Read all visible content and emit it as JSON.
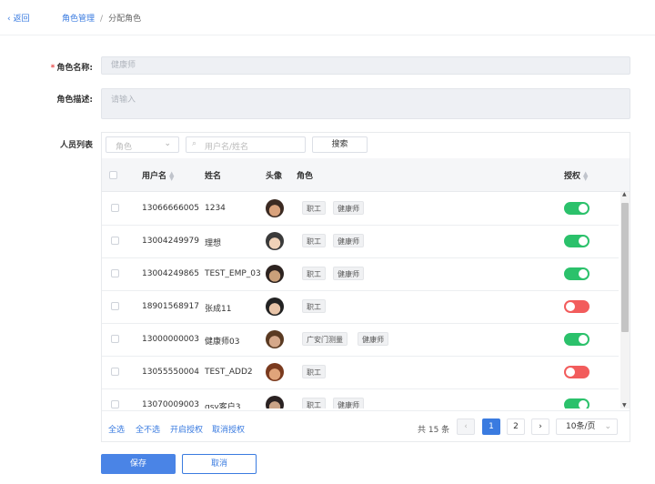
{
  "header": {
    "back_label": "返回",
    "breadcrumb": [
      "角色管理",
      "分配角色"
    ]
  },
  "form": {
    "role_name_label": "角色名称:",
    "role_name_value": "健康师",
    "role_desc_label": "角色描述:",
    "role_desc_placeholder": "请输入",
    "members_label": "人员列表"
  },
  "filters": {
    "role_placeholder": "角色",
    "search_placeholder": "用户名/姓名",
    "search_button": "搜索"
  },
  "table": {
    "columns": [
      "用户名",
      "姓名",
      "头像",
      "角色",
      "授权"
    ],
    "rows": [
      {
        "username": "13066666005",
        "name": "1234",
        "roles": [
          "职工",
          "健康师"
        ],
        "authorized": true
      },
      {
        "username": "13004249979",
        "name": "理想",
        "roles": [
          "职工",
          "健康师"
        ],
        "authorized": true
      },
      {
        "username": "13004249865",
        "name": "TEST_EMP_03",
        "roles": [
          "职工",
          "健康师"
        ],
        "authorized": true
      },
      {
        "username": "18901568917",
        "name": "张成11",
        "roles": [
          "职工"
        ],
        "authorized": false
      },
      {
        "username": "13000000003",
        "name": "健康师03",
        "roles": [
          "广安门测量",
          "健康师"
        ],
        "authorized": true
      },
      {
        "username": "13055550004",
        "name": "TEST_ADD2",
        "roles": [
          "职工"
        ],
        "authorized": false
      },
      {
        "username": "13070009003",
        "name": "qsy客户3",
        "roles": [
          "职工",
          "健康师"
        ],
        "authorized": true
      }
    ]
  },
  "footer": {
    "actions": [
      "全选",
      "全不选",
      "开启授权",
      "取消授权"
    ],
    "total": "共 15 条",
    "pages": [
      "1",
      "2"
    ],
    "current_page": "1",
    "page_size": "10条/页"
  },
  "buttons": {
    "save": "保存",
    "cancel": "取消"
  },
  "colors": {
    "accent": "#3a7be0",
    "on": "#2bc16b",
    "off": "#f25c5c"
  }
}
